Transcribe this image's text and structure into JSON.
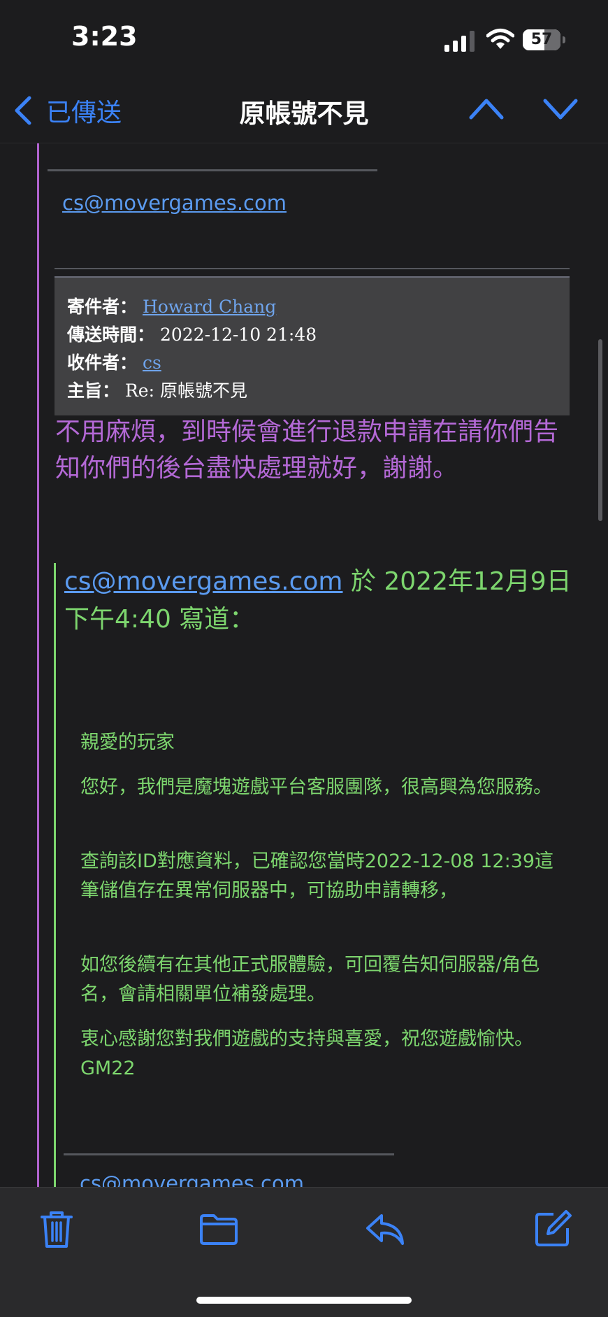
{
  "status_bar": {
    "time": "3:23",
    "battery_level": "57",
    "battery_percent": 57
  },
  "nav": {
    "back_label": "已傳送",
    "title": "原帳號不見"
  },
  "email": {
    "top_link": "cs@movergames.com",
    "header": {
      "from_label": "寄件者：",
      "from_value": "Howard Chang",
      "sent_label": "傳送時間：",
      "sent_value": "2022-12-10 21:48",
      "to_label": "收件者：",
      "to_value": "cs",
      "subject_label": "主旨：",
      "subject_value": "Re: 原帳號不見"
    },
    "reply_message": "不用麻煩，到時候會進行退款申請在請你們告知你們的後台盡快處理就好，謝謝。",
    "quote_header": {
      "link": "cs@movergames.com",
      "text": " 於 2022年12月9日 下午4:40 寫道："
    },
    "quoted_paragraphs": [
      "親愛的玩家",
      "您好，我們是魔塊遊戲平台客服團隊，很高興為您服務。",
      "查詢該ID對應資料，已確認您當時2022-12-08 12:39這筆儲值存在異常伺服器中，可協助申請轉移，",
      "如您後續有在其他正式服體驗，可回覆告知伺服器/角色名，會請相關單位補發處理。",
      "衷心感謝您對我們遊戲的支持與喜愛，祝您遊戲愉快。GM22"
    ],
    "bottom_link": "cs@movergames.com"
  },
  "colors": {
    "accent": "#3b82f6",
    "link": "#5b9bf0",
    "purple_quote": "#b469d6",
    "green_quote": "#7dd66e",
    "background": "#1c1c1e"
  },
  "icons": {
    "back": "chevron-left-icon",
    "prev": "chevron-up-icon",
    "next": "chevron-down-icon",
    "trash": "trash-icon",
    "folder": "folder-icon",
    "reply": "reply-icon",
    "compose": "compose-icon"
  }
}
